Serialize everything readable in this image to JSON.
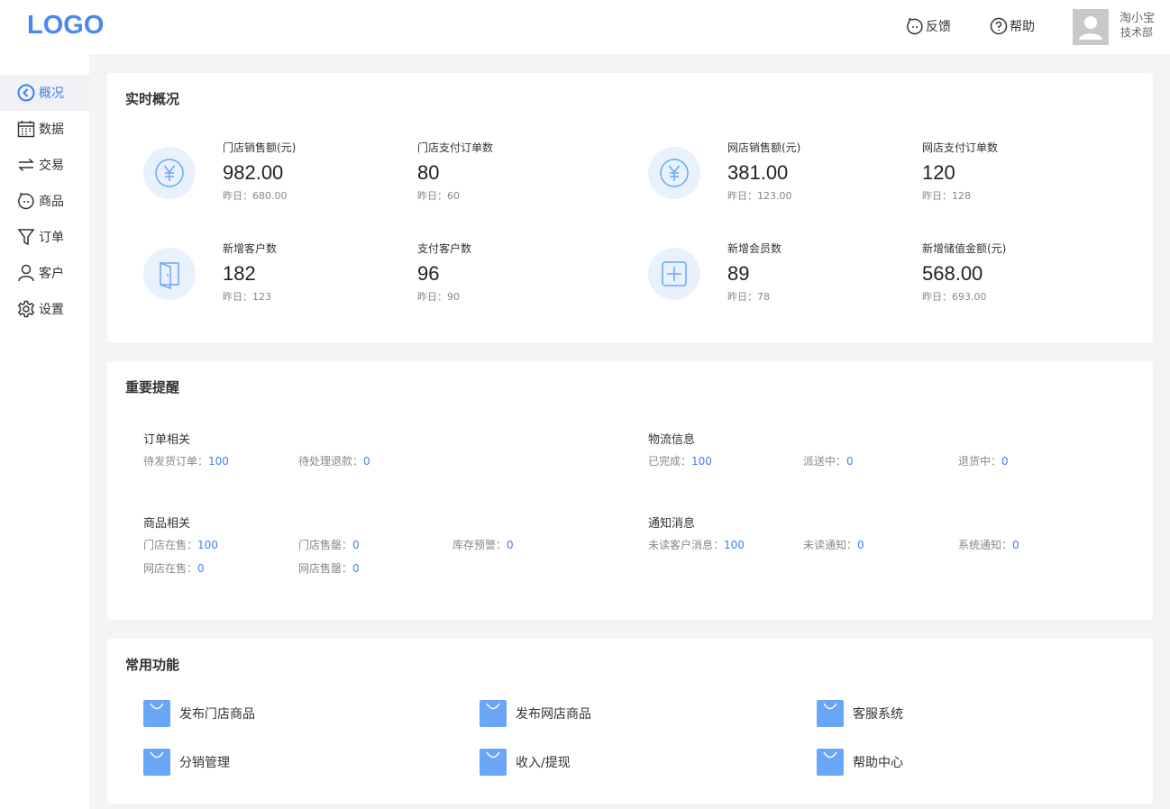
{
  "header": {
    "logo": "LOGO",
    "feedback": "反馈",
    "help": "帮助",
    "user_name": "淘小宝",
    "user_dept": "技术部"
  },
  "sidebar": {
    "items": [
      {
        "label": "概况",
        "icon": "chevron-left-circle-icon",
        "active": true
      },
      {
        "label": "数据",
        "icon": "calendar-icon"
      },
      {
        "label": "交易",
        "icon": "exchange-icon"
      },
      {
        "label": "商品",
        "icon": "face-icon"
      },
      {
        "label": "订单",
        "icon": "funnel-icon"
      },
      {
        "label": "客户",
        "icon": "user-icon"
      },
      {
        "label": "设置",
        "icon": "gear-icon"
      }
    ]
  },
  "overview": {
    "title": "实时概况",
    "stats": [
      {
        "label": "门店销售额(元)",
        "value": "982.00",
        "prev": "昨日：680.00"
      },
      {
        "label": "门店支付订单数",
        "value": "80",
        "prev": "昨日：60"
      },
      {
        "label": "网店销售额(元)",
        "value": "381.00",
        "prev": "昨日：123.00"
      },
      {
        "label": "网店支付订单数",
        "value": "120",
        "prev": "昨日：128"
      },
      {
        "label": "新增客户数",
        "value": "182",
        "prev": "昨日：123"
      },
      {
        "label": "支付客户数",
        "value": "96",
        "prev": "昨日：90"
      },
      {
        "label": "新增会员数",
        "value": "89",
        "prev": "昨日：78"
      },
      {
        "label": "新增储值金额(元)",
        "value": "568.00",
        "prev": "昨日：693.00"
      }
    ]
  },
  "reminders": {
    "title": "重要提醒",
    "groups": [
      {
        "title": "订单相关",
        "items": [
          {
            "label": "待发货订单：",
            "value": "100"
          },
          {
            "label": "待处理退款：",
            "value": "0"
          }
        ]
      },
      {
        "title": "物流信息",
        "items": [
          {
            "label": "已完成：",
            "value": "100"
          },
          {
            "label": "派送中：",
            "value": "0"
          },
          {
            "label": "退货中：",
            "value": "0"
          }
        ]
      },
      {
        "title": "商品相关",
        "items": [
          {
            "label": "门店在售：",
            "value": "100"
          },
          {
            "label": "门店售罄：",
            "value": "0"
          },
          {
            "label": "库存预警：",
            "value": "0"
          },
          {
            "label": "网店在售：",
            "value": "0"
          },
          {
            "label": "网店售罄：",
            "value": "0"
          }
        ]
      },
      {
        "title": "通知消息",
        "items": [
          {
            "label": "未读客户消息：",
            "value": "100"
          },
          {
            "label": "未读通知：",
            "value": "0"
          },
          {
            "label": "系统通知：",
            "value": "0"
          }
        ]
      }
    ]
  },
  "functions": {
    "title": "常用功能",
    "items": [
      {
        "label": "发布门店商品"
      },
      {
        "label": "发布网店商品"
      },
      {
        "label": "客服系统"
      },
      {
        "label": "分销管理"
      },
      {
        "label": "收入/提现"
      },
      {
        "label": "帮助中心"
      }
    ]
  },
  "colors": {
    "accent": "#3d7ff0",
    "logo": "#4a88f0",
    "icon_bg": "#e9f1fd",
    "bag": "#6aa6f8"
  }
}
